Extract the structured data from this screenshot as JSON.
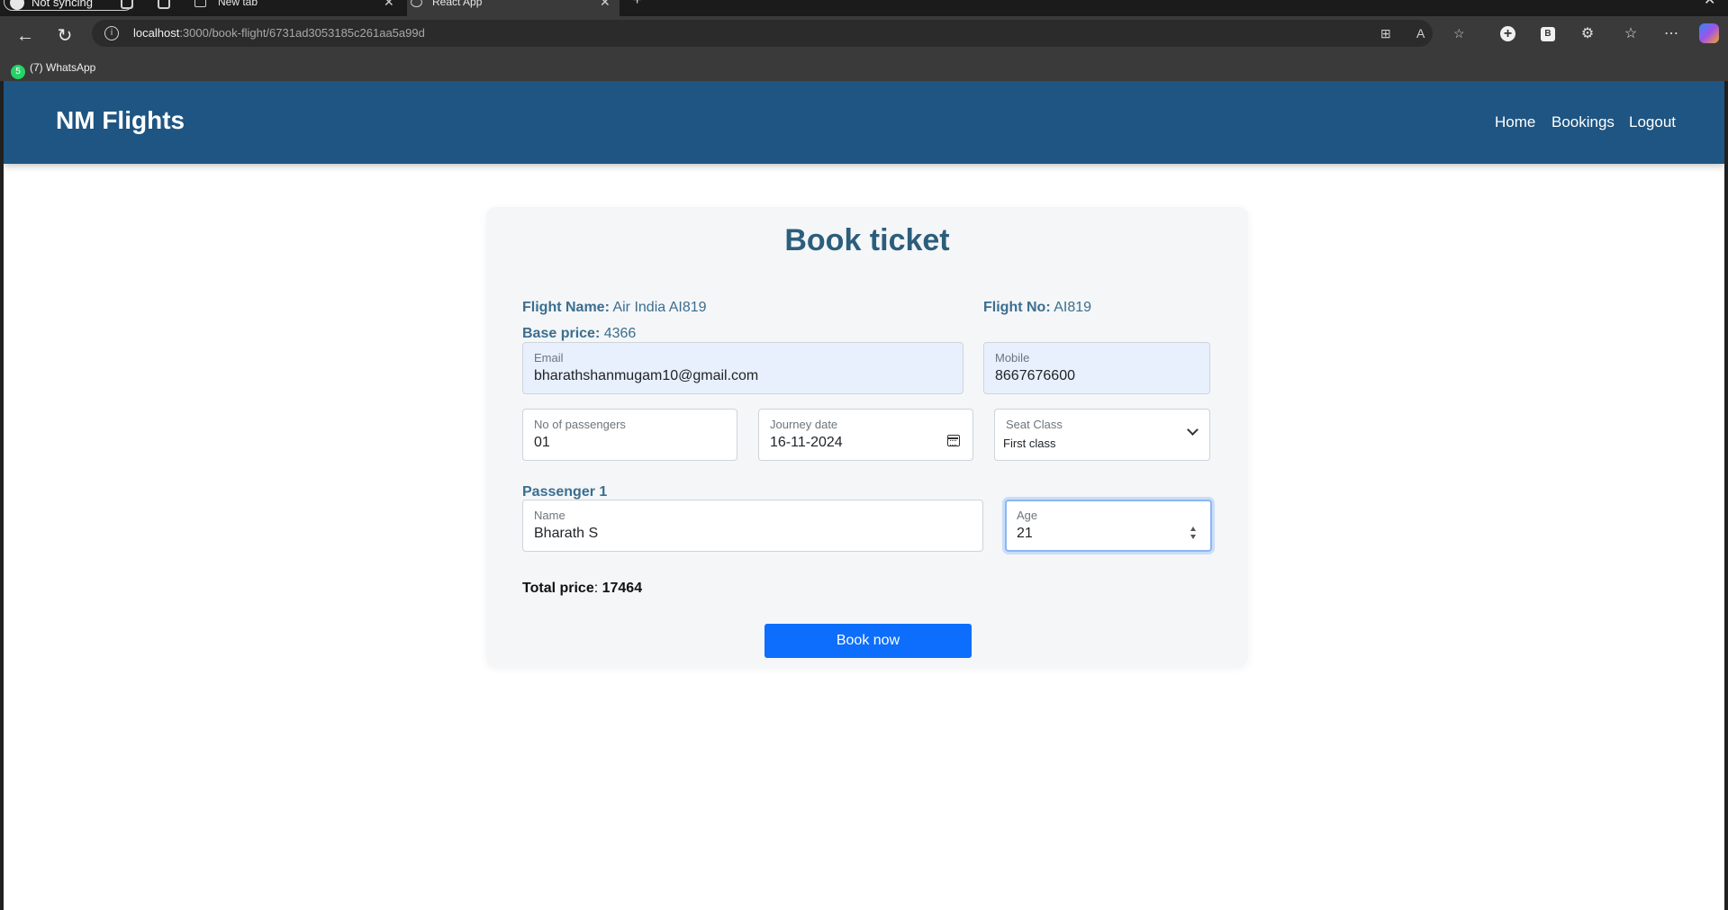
{
  "browser": {
    "profile_label": "Not syncing",
    "tabs": [
      {
        "title": "New tab"
      },
      {
        "title": "React App"
      }
    ],
    "url_host": "localhost",
    "url_path": ":3000/book-flight/6731ad3053185c261aa5a99d",
    "bookmarks": [
      {
        "label": "(7) WhatsApp",
        "badge": "5"
      }
    ]
  },
  "navbar": {
    "brand": "NM Flights",
    "links": [
      "Home",
      "Bookings",
      "Logout"
    ],
    "bg_color": "#1e5582"
  },
  "form": {
    "title": "Book ticket",
    "flight_name_label": "Flight Name:",
    "flight_name": "Air India AI819",
    "flight_no_label": "Flight No:",
    "flight_no": "AI819",
    "base_price_label": "Base price:",
    "base_price": "4366",
    "email": {
      "label": "Email",
      "value": "bharathshanmugam10@gmail.com"
    },
    "mobile": {
      "label": "Mobile",
      "value": "8667676600"
    },
    "passengers": {
      "label": "No of passengers",
      "value": "01"
    },
    "journey_date": {
      "label": "Journey date",
      "value": "16-11-2024"
    },
    "seat_class": {
      "label": "Seat Class",
      "value": "First class"
    },
    "passenger_heading": "Passenger 1",
    "passenger_name": {
      "label": "Name",
      "value": "Bharath S"
    },
    "passenger_age": {
      "label": "Age",
      "value": "21"
    },
    "total_price_label": "Total price",
    "total_price": "17464",
    "submit_label": "Book now",
    "accent_color": "#0d6efd"
  }
}
